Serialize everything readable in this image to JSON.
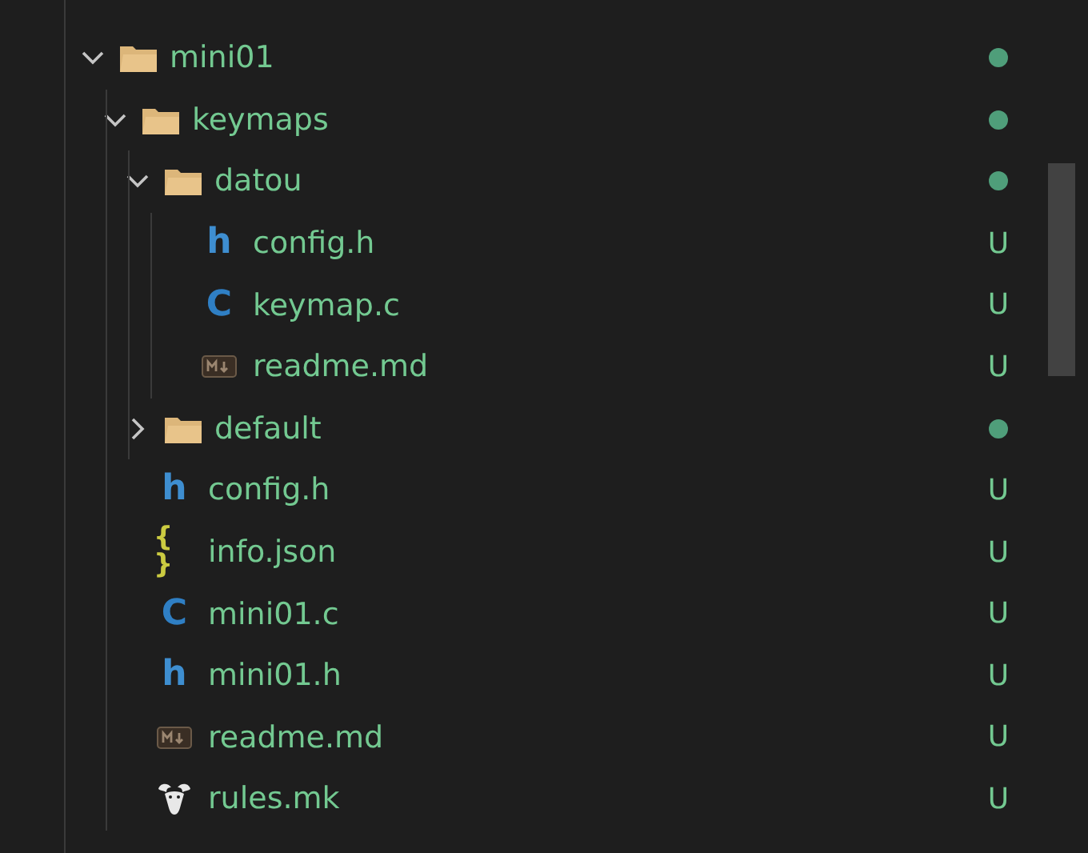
{
  "tree": [
    {
      "name": "mini01",
      "kind": "folder",
      "expanded": true,
      "modified": true,
      "children": [
        {
          "name": "keymaps",
          "kind": "folder",
          "expanded": true,
          "modified": true,
          "children": [
            {
              "name": "datou",
              "kind": "folder",
              "expanded": true,
              "modified": true,
              "children": [
                {
                  "name": "config.h",
                  "kind": "header",
                  "glyph": "h",
                  "badge": "U"
                },
                {
                  "name": "keymap.c",
                  "kind": "source",
                  "glyph": "C",
                  "badge": "U"
                },
                {
                  "name": "readme.md",
                  "kind": "markdown",
                  "badge": "U"
                }
              ]
            },
            {
              "name": "default",
              "kind": "folder",
              "expanded": false,
              "modified": true
            }
          ]
        },
        {
          "name": "config.h",
          "kind": "header",
          "glyph": "h",
          "badge": "U"
        },
        {
          "name": "info.json",
          "kind": "json",
          "glyph": "{ }",
          "badge": "U"
        },
        {
          "name": "mini01.c",
          "kind": "source",
          "glyph": "C",
          "badge": "U"
        },
        {
          "name": "mini01.h",
          "kind": "header",
          "glyph": "h",
          "badge": "U"
        },
        {
          "name": "readme.md",
          "kind": "markdown",
          "badge": "U"
        },
        {
          "name": "rules.mk",
          "kind": "makefile",
          "badge": "U"
        }
      ]
    }
  ]
}
